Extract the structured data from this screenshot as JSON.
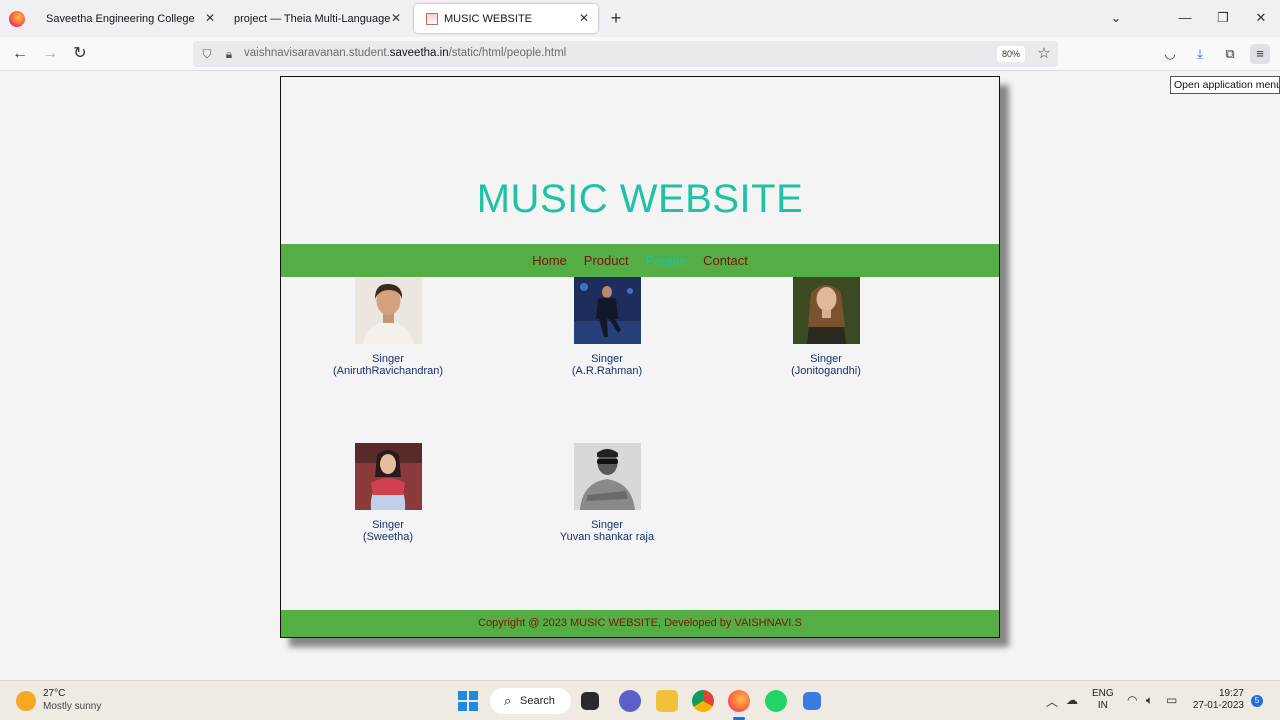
{
  "browser": {
    "tabs": [
      {
        "label": "Saveetha Engineering College",
        "close": "✕"
      },
      {
        "label": "project — Theia Multi-Language Ex",
        "close": "✕"
      },
      {
        "label": "MUSIC WEBSITE",
        "close": "✕"
      }
    ],
    "new_tab": "+",
    "url_prefix": "vaishnavisaravanan.student.",
    "url_domain": "saveetha.in",
    "url_path": "/static/html/people.html",
    "zoom": "80%",
    "tooltip": "Open application menu"
  },
  "site": {
    "title": "MUSIC WEBSITE",
    "nav": [
      {
        "label": "Home",
        "active": false
      },
      {
        "label": "Product",
        "active": false
      },
      {
        "label": "People",
        "active": true
      },
      {
        "label": "Contact",
        "active": false
      }
    ],
    "people": [
      {
        "line1": "Singer",
        "line2": "(AniruthRavichandran)"
      },
      {
        "line1": "Singer",
        "line2": "(A.R.Rahman)"
      },
      {
        "line1": "Singer",
        "line2": "(Jonitogandhi)"
      },
      {
        "line1": "Singer",
        "line2": "(Sweetha)"
      },
      {
        "line1": "Singer",
        "line2": "Yuvan shankar raja"
      }
    ],
    "footer": "Copyright @ 2023 MUSIC WEBSITE, Developed by VAISHNAVI.S",
    "colors": {
      "title": "#1fc2a2",
      "nav_bg": "#55ae45",
      "nav_link": "#7a1606",
      "caption": "#16326e"
    }
  },
  "taskbar": {
    "temperature": "27°C",
    "weather": "Mostly sunny",
    "search_label": "Search",
    "lang_line1": "ENG",
    "lang_line2": "IN",
    "time": "19:27",
    "date": "27-01-2023",
    "notifications": "5"
  }
}
